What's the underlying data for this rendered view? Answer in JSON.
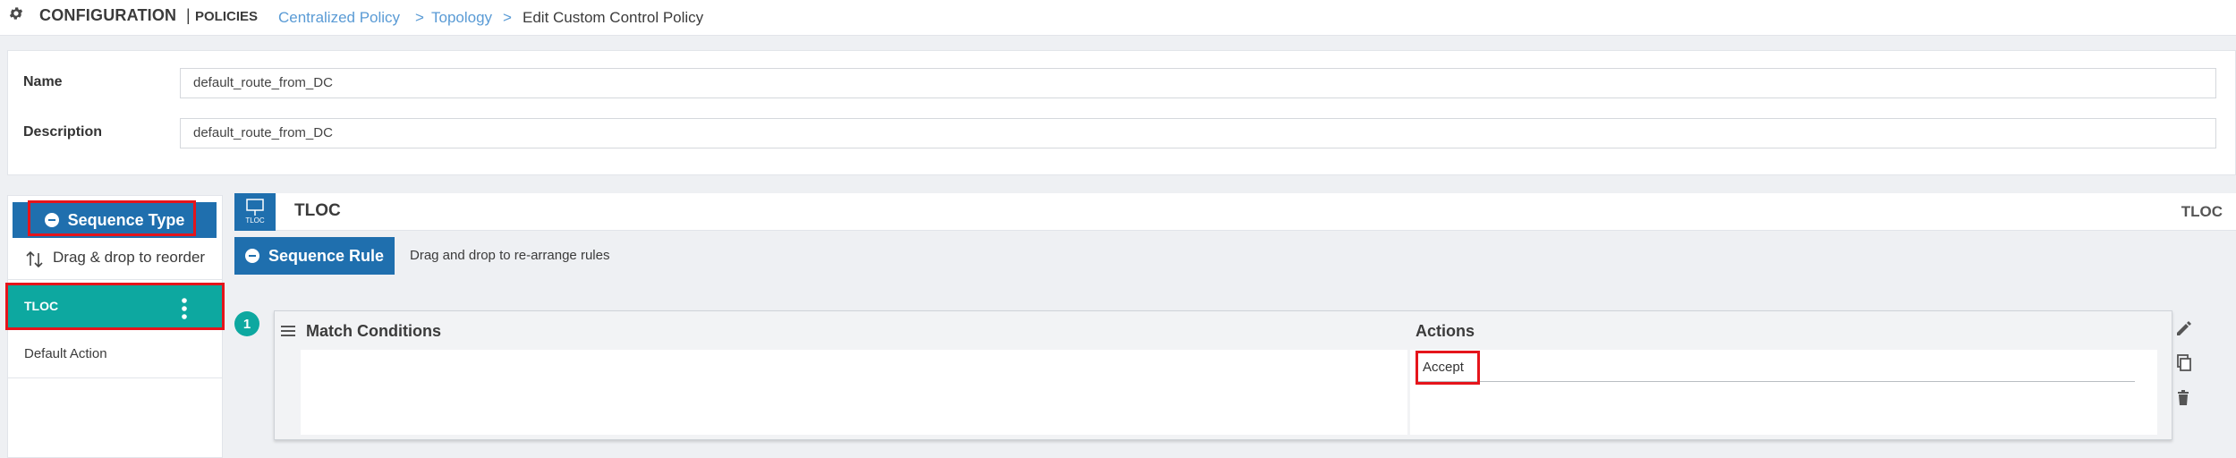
{
  "breadcrumb": {
    "section": "CONFIGURATION",
    "separator": "|",
    "subsection": "POLICIES",
    "links": [
      "Centralized Policy",
      "Topology"
    ],
    "arrow": ">",
    "current": "Edit Custom Control Policy"
  },
  "form": {
    "name_label": "Name",
    "name_value": "default_route_from_DC",
    "description_label": "Description",
    "description_value": "default_route_from_DC"
  },
  "sidebar": {
    "sequence_type_label": "Sequence Type",
    "drag_label": "Drag & drop to reorder",
    "items": [
      {
        "label": "TLOC",
        "selected": true
      },
      {
        "label": "Default Action",
        "selected": false
      }
    ]
  },
  "main": {
    "badge_text": "TLOC",
    "title": "TLOC",
    "right_label": "TLOC",
    "sequence_rule_label": "Sequence Rule",
    "drag_hint": "Drag and drop to re-arrange rules",
    "rule": {
      "number": "1",
      "match_label": "Match Conditions",
      "actions_label": "Actions",
      "action_value": "Accept"
    }
  },
  "colors": {
    "primary": "#1f6fae",
    "teal": "#0da8a0",
    "highlight": "#e5141b",
    "link": "#5a9bd5"
  },
  "icons": [
    "gear-icon",
    "minus-circle-icon",
    "sort-icon",
    "kebab-icon",
    "tloc-icon",
    "hamburger-icon",
    "edit-icon",
    "copy-icon",
    "delete-icon"
  ]
}
